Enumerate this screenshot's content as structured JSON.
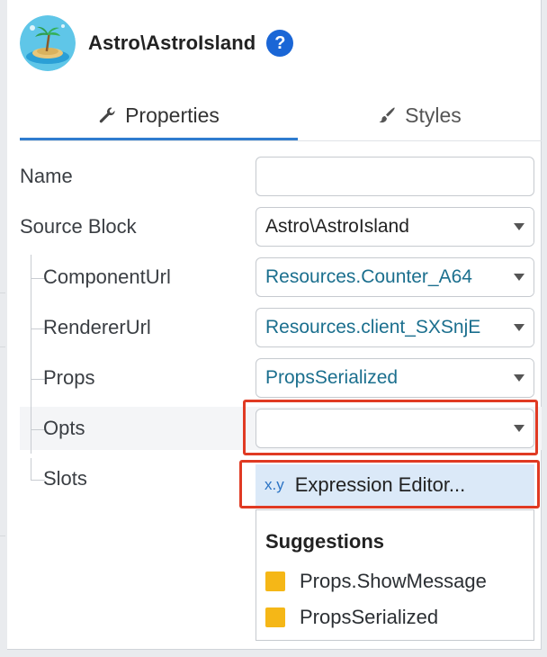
{
  "header": {
    "title": "Astro\\AstroIsland",
    "help_label": "?"
  },
  "tabs": [
    {
      "label": "Properties",
      "icon": "wrench-icon",
      "active": true
    },
    {
      "label": "Styles",
      "icon": "brush-icon",
      "active": false
    }
  ],
  "fields": {
    "name": {
      "label": "Name",
      "value": ""
    },
    "source_block": {
      "label": "Source Block",
      "value": "Astro\\AstroIsland"
    },
    "component_url": {
      "label": "ComponentUrl",
      "value": "Resources.Counter_A64"
    },
    "renderer_url": {
      "label": "RendererUrl",
      "value": "Resources.client_SXSnjE"
    },
    "props": {
      "label": "Props",
      "value": "PropsSerialized"
    },
    "opts": {
      "label": "Opts",
      "value": ""
    },
    "slots": {
      "label": "Slots"
    }
  },
  "dropdown": {
    "expression_prefix": "x.y",
    "expression_label": "Expression Editor...",
    "suggestions_title": "Suggestions",
    "suggestions": [
      "Props.ShowMessage",
      "PropsSerialized"
    ]
  },
  "colors": {
    "accent": "#2f7ccf",
    "help": "#1a66d6",
    "highlight": "#e03a23",
    "link_text": "#1b6f8e",
    "suggestion_swatch": "#f5b717",
    "expression_bg": "#dbe9f8"
  }
}
